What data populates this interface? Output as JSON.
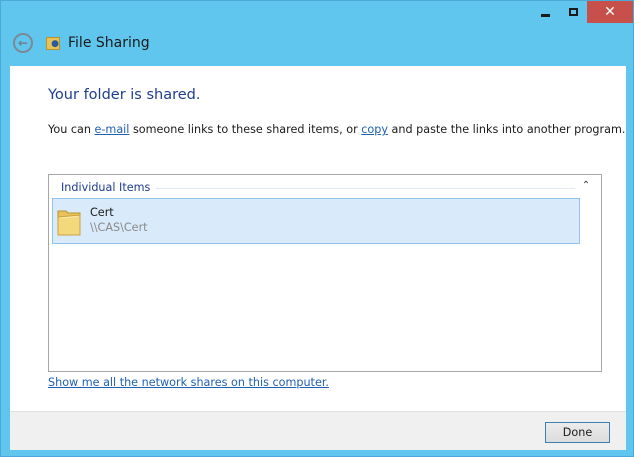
{
  "window": {
    "title": "File Sharing",
    "controls": {
      "minimize_icon": "minimize-icon",
      "maximize_icon": "maximize-icon",
      "close_label": "✕"
    },
    "back_icon": "back-arrow-icon",
    "app_icon": "file-sharing-icon"
  },
  "main": {
    "heading": "Your folder is shared.",
    "description": {
      "prefix": "You can ",
      "email_link": "e-mail",
      "middle": " someone links to these shared items, or ",
      "copy_link": "copy",
      "suffix": " and paste the links into another program."
    },
    "group": {
      "header": "Individual Items",
      "chevron": "chevron-up-icon"
    },
    "items": [
      {
        "name": "Cert",
        "path": "\\\\CAS\\Cert",
        "icon": "folder-icon"
      }
    ],
    "network_link": "Show me all the network shares on this computer."
  },
  "footer": {
    "done_label": "Done"
  },
  "colors": {
    "titlebar": "#61c6ee",
    "close_button": "#c7504a",
    "heading": "#1e3d8f",
    "link": "#1f5fb4",
    "selection": "#d9ebfa",
    "selection_border": "#8fc2ef"
  }
}
